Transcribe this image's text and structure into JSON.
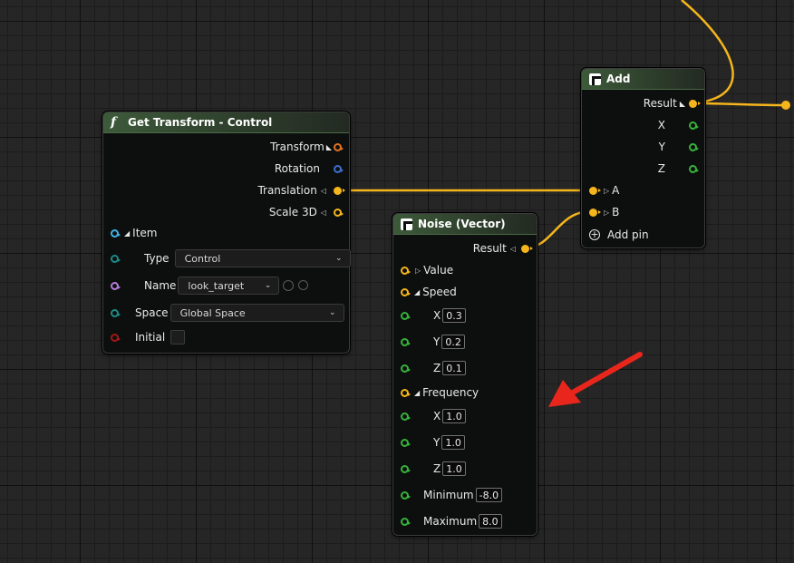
{
  "colors": {
    "vector_pin": "#f5b51c",
    "float_pin": "#37b13a",
    "transform_pin": "#e5731f",
    "rotation_pin": "#3b6fd0",
    "item_pin": "#41b0e8",
    "enum_pin": "#1d8a85",
    "name_pin": "#b57ad9",
    "bool_pin": "#a01818",
    "wire": "#f5b51c",
    "annotation_arrow": "#e8261c"
  },
  "get_transform": {
    "icon": "function-icon",
    "title": "Get Transform - Control",
    "outputs": {
      "transform": "Transform",
      "rotation": "Rotation",
      "translation": "Translation",
      "scale": "Scale 3D"
    },
    "item_label": "Item",
    "type_label": "Type",
    "type_value": "Control",
    "name_label": "Name",
    "name_value": "look_target",
    "space_label": "Space",
    "space_value": "Global Space",
    "initial_label": "Initial",
    "initial_checked": false
  },
  "add": {
    "icon": "rig-unit-icon",
    "title": "Add",
    "result_label": "Result",
    "x_label": "X",
    "y_label": "Y",
    "z_label": "Z",
    "a_label": "A",
    "b_label": "B",
    "add_pin_label": "Add pin"
  },
  "noise": {
    "icon": "rig-unit-icon",
    "title": "Noise (Vector)",
    "result_label": "Result",
    "value_label": "Value",
    "speed_label": "Speed",
    "speed": {
      "x": "0.3",
      "y": "0.2",
      "z": "0.1"
    },
    "frequency_label": "Frequency",
    "frequency": {
      "x": "1.0",
      "y": "1.0",
      "z": "1.0"
    },
    "x_label": "X",
    "y_label": "Y",
    "z_label": "Z",
    "minimum_label": "Minimum",
    "minimum_value": "-8.0",
    "maximum_label": "Maximum",
    "maximum_value": "8.0"
  }
}
